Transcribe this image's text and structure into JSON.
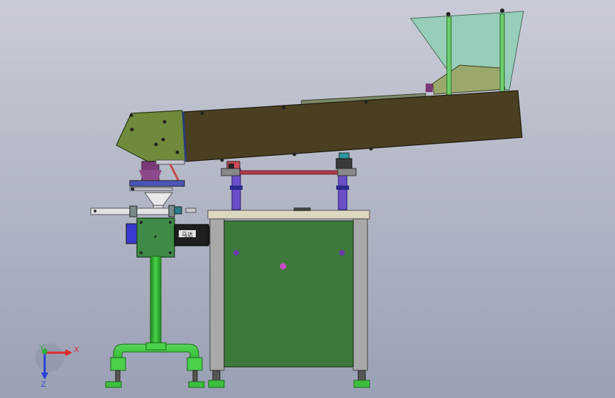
{
  "viewport": {
    "background_top": "#c9ccd6",
    "background_bottom": "#9aa0b4"
  },
  "model": {
    "motor_nameplate": "马达"
  },
  "colors": {
    "hopper_glass": "#8ecfb4",
    "hopper_frame": "#9aa86b",
    "chute_body": "#4b3f22",
    "chute_head": "#6f8a3a",
    "cabinet_panel": "#3e7a3c",
    "cabinet_frame": "#a9a9a9",
    "cabinet_top": "#ddd8c0",
    "pipe_green": "#3cbf3c",
    "post_purple": "#6a4fc9",
    "belt_red": "#b23a4a",
    "funnel_purple": "#7a3a78",
    "motor_black": "#1e1e1e"
  },
  "triad": {
    "x_label": "X",
    "y_label": "Y",
    "z_label": "Z",
    "x_color": "#e02a2a",
    "y_color": "#2fae3a",
    "z_color": "#2a3fd6"
  }
}
